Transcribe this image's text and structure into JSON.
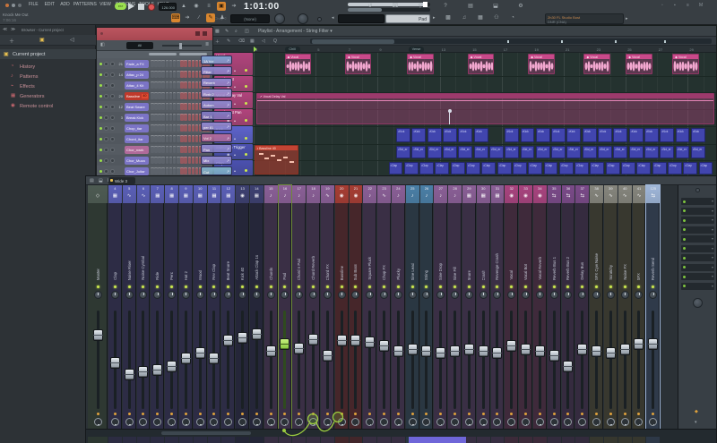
{
  "colors": {
    "toolbar": "#383e43",
    "accent_green": "#9adf4f",
    "record_red": "#e05555",
    "rack_title": "#b8535f",
    "playlist_bg": "#24322f",
    "vocal_track": "#b2437c",
    "kick_track": "#5d62cc",
    "subkick_track": "#4b50b0",
    "clip_tile": "#4145ae",
    "orange_led": "#e0a23c"
  },
  "menu": [
    "FILE",
    "EDIT",
    "ADD",
    "PATTERNS",
    "VIEW",
    "OPTIONS",
    "TOOLS",
    "HELP"
  ],
  "project": {
    "title": "Knock Me Out",
    "time": "7:06:16",
    "free_label": "Free Chop ©"
  },
  "transport": {
    "pat": "PAT",
    "bpm": "126.000",
    "time": "1:01:00",
    "none_lcd": "(None)",
    "pattern_lcd": "Pad"
  },
  "hint": {
    "line1": "2h30  FL Studio Bost",
    "line2": "DNR (CNA)"
  },
  "toolbar": {
    "row1_icons": [
      {
        "g": "▲",
        "n": "metronome-icon"
      },
      {
        "g": "◉",
        "n": "wait-for-input-icon"
      },
      {
        "g": "≡",
        "n": "blend-notes-icon"
      },
      {
        "g": "▣",
        "n": "loop-record-icon",
        "lit": true
      },
      {
        "g": "➔",
        "n": "step-edit-icon"
      }
    ],
    "right1_icons": [
      {
        "g": "↺",
        "n": "sync-icon"
      },
      {
        "g": "⌧",
        "n": "abort-icon"
      },
      {
        "g": "⚲",
        "n": "mic-icon"
      },
      {
        "g": "?",
        "n": "help-icon"
      },
      {
        "g": "▤",
        "n": "save-icon"
      },
      {
        "g": "⬓",
        "n": "monitor-icon"
      },
      {
        "g": "⚙",
        "n": "settings-icon"
      }
    ],
    "row2_icons": [
      {
        "g": "⌨",
        "n": "typing-keyboard-icon",
        "lit": true
      },
      {
        "g": "➔",
        "n": "follow-playback-icon"
      },
      {
        "g": "∕",
        "n": "slide-tool-icon"
      },
      {
        "g": "✎",
        "n": "draw-tool-icon",
        "lit": true
      },
      {
        "g": "♟",
        "n": "smart-macros-icon"
      }
    ],
    "row2b_icons": [
      {
        "g": "▩",
        "n": "playlist-window-icon"
      },
      {
        "g": "♫",
        "n": "piano-roll-window-icon"
      },
      {
        "g": "▦",
        "n": "channel-rack-window-icon"
      },
      {
        "g": "⚇",
        "n": "mixer-window-icon"
      },
      {
        "g": "◔",
        "n": "browser-window-icon"
      }
    ],
    "far_right_icons": [
      {
        "g": "▫",
        "n": "mini-icon-1"
      },
      {
        "g": "▪",
        "n": "mini-icon-2"
      },
      {
        "g": "≡",
        "n": "mini-icon-3"
      },
      {
        "g": "M",
        "n": "midi-icon"
      }
    ]
  },
  "browser": {
    "header": "Browser - Current project",
    "tabs": [
      {
        "g": "＋",
        "n": "browser-add-tab"
      },
      {
        "g": "▣",
        "n": "browser-folder-tab",
        "color": "#e8c050"
      },
      {
        "g": "◁",
        "n": "browser-audio-tab"
      }
    ],
    "root": "Current project",
    "items": [
      {
        "label": "History",
        "g": "◔"
      },
      {
        "label": "Patterns",
        "g": "♪"
      },
      {
        "label": "Effects",
        "g": "⌁"
      },
      {
        "label": "Generators",
        "g": "▦"
      },
      {
        "label": "Remote control",
        "g": "◉"
      }
    ]
  },
  "rack": {
    "filter": "All",
    "channels": [
      {
        "num": "21",
        "name": "Fade_a FX"
      },
      {
        "num": "14",
        "name": "Attac_p 24"
      },
      {
        "num": "",
        "name": "Attac_4 Kit"
      },
      {
        "num": "20",
        "name": "Bassline",
        "badge": "40",
        "selected": true
      },
      {
        "num": "12",
        "name": "Beat Sware"
      },
      {
        "num": "3",
        "name": "Break Kick"
      },
      {
        "num": "",
        "name": "Chop_itar"
      },
      {
        "num": "",
        "name": "Chord_itar"
      },
      {
        "num": "",
        "name": "Chor_nwrk",
        "pink": true
      },
      {
        "num": "",
        "name": "Chor_Muza"
      },
      {
        "num": "",
        "name": "Chor_Juitar"
      }
    ]
  },
  "side_buttons": [
    {
      "label": "1A Vol",
      "color": "#7f9fd0"
    },
    {
      "label": "Filter",
      "color": "#8d86cc"
    },
    {
      "label": "Reverb",
      "color": "#8d86cc"
    },
    {
      "label": "Rvrb 2",
      "color": "#9a8fd0"
    },
    {
      "label": "Autom",
      "color": "#8d86cc"
    },
    {
      "label": "Bar 1",
      "color": "#7f78c0"
    },
    {
      "label": "per 81",
      "color": "#8d86cc"
    },
    {
      "label": "Vol 2",
      "color": "#b06a9a"
    },
    {
      "label": "Pan",
      "color": "#8d86cc"
    },
    {
      "label": "Mix",
      "color": "#8d86cc"
    },
    {
      "label": "Cut",
      "color": "#7fb0c8"
    }
  ],
  "playlist": {
    "title": "Playlist - Arrangement - String Filter",
    "title_icons": [
      {
        "g": "▩",
        "n": "playlist-menu-icon"
      },
      {
        "g": "✎",
        "n": "playlist-draw-icon"
      },
      {
        "g": "⌕",
        "n": "playlist-zoom-icon"
      },
      {
        "g": "◫",
        "n": "playlist-view-icon"
      }
    ],
    "tool_icons": [
      {
        "g": "＋",
        "n": "pl-add-icon"
      },
      {
        "g": "✎",
        "n": "pl-pencil-icon"
      },
      {
        "g": "⌫",
        "n": "pl-delete-icon"
      },
      {
        "g": "▦",
        "n": "pl-paint-icon"
      },
      {
        "g": "◁",
        "n": "pl-playback-icon"
      },
      {
        "g": "Q",
        "n": "pl-quantize-icon"
      }
    ],
    "markers": [
      {
        "label": "Chill",
        "bar": 3
      },
      {
        "label": "Verse",
        "bar": 11
      }
    ],
    "bar_labels": [
      1,
      3,
      5,
      7,
      9,
      11,
      13,
      15,
      17,
      19,
      21,
      23,
      25,
      27,
      29
    ],
    "tracks": [
      {
        "name": "Vocal",
        "color": "#b2437c",
        "h": 26
      },
      {
        "name": "Vocal Bost",
        "color": "#b2437c",
        "h": 18
      },
      {
        "name": "Vocal Delay Val",
        "color": "#b2437c",
        "h": 19
      },
      {
        "name": "Vocal Bost Pan",
        "color": "#b2437c",
        "h": 19
      },
      {
        "name": "Kick",
        "color": "#5d62cc",
        "h": 20
      },
      {
        "name": "Sidechain Trigger",
        "color": "#4b50b0",
        "h": 18
      },
      {
        "name": "Clap",
        "color": "#4b50b0",
        "h": 18
      }
    ],
    "audio_clips": {
      "label": "Vocal",
      "track": 0,
      "len": 1.7,
      "starts": [
        3,
        6.9,
        10.9,
        14.8,
        18.7,
        22.3,
        25.0,
        28.0
      ]
    },
    "automation_clip": {
      "label": "Vocal Delay Val",
      "track": 2,
      "span": 2,
      "start": 1.2,
      "end": 30.8
    },
    "pattern_clip": {
      "label": "Bassline 40",
      "track": 5,
      "span": 2,
      "start": 1.05,
      "end": 3.9
    },
    "tiled_clips": [
      {
        "label": "Kick",
        "track": 4,
        "start": 10.2,
        "end": 30,
        "gap": 16
      },
      {
        "label": "Sid_er",
        "track": 5,
        "start": 10.2,
        "end": 30
      },
      {
        "label": "Clap",
        "track": 6,
        "start": 9.7,
        "end": 30
      }
    ]
  },
  "mixer": {
    "tab": "Wide 3",
    "title_icons": [
      {
        "g": "▤",
        "n": "mixer-menu-icon"
      },
      {
        "g": "⬓",
        "n": "mixer-detach-icon"
      },
      {
        "g": "⧉",
        "n": "mixer-layout-icon"
      }
    ],
    "groups": {
      "master": {
        "h": "#4d5a52",
        "b": "#2e3832"
      },
      "blue": {
        "h": "#5a5fb6",
        "b": "#2d2c45"
      },
      "navy": {
        "h": "#3d4070",
        "b": "#252639"
      },
      "mauve": {
        "h": "#8a5f96",
        "b": "#3a2f45"
      },
      "red": {
        "h": "#a63d33",
        "b": "#46262a"
      },
      "steel": {
        "h": "#4a7fa6",
        "b": "#2a3742"
      },
      "magenta": {
        "h": "#a8437e",
        "b": "#3f2a3b"
      },
      "bus": {
        "h": "#7a4a88",
        "b": "#352b3f"
      },
      "gray": {
        "h": "#85857d",
        "b": "#38382f"
      },
      "send": {
        "h": "#9fb6d8",
        "b": "#2f3a4a"
      }
    },
    "strips": [
      {
        "num": "",
        "name": "Master",
        "group": "master",
        "fader": 0.78,
        "icon": "◇"
      },
      {
        "num": "4",
        "name": "Clap",
        "group": "blue",
        "fader": 0.46,
        "icon": "▦"
      },
      {
        "num": "5",
        "name": "Noise Riser",
        "group": "blue",
        "fader": 0.33,
        "icon": "∿"
      },
      {
        "num": "6",
        "name": "Noise Cymbal",
        "group": "blue",
        "fader": 0.36,
        "icon": "∿"
      },
      {
        "num": "7",
        "name": "Ride",
        "group": "blue",
        "fader": 0.38,
        "icon": "▦"
      },
      {
        "num": "8",
        "name": "Perc",
        "group": "blue",
        "fader": 0.42,
        "icon": "▦"
      },
      {
        "num": "9",
        "name": "Hat 2",
        "group": "blue",
        "fader": 0.52,
        "icon": "▦"
      },
      {
        "num": "10",
        "name": "Wood",
        "group": "blue",
        "fader": 0.58,
        "icon": "▦"
      },
      {
        "num": "11",
        "name": "Rev Clap",
        "group": "blue",
        "fader": 0.52,
        "icon": "▦"
      },
      {
        "num": "12",
        "name": "Beat Snare",
        "group": "blue",
        "fader": 0.72,
        "icon": "▦"
      },
      {
        "num": "13",
        "name": "Kick 40",
        "group": "navy",
        "fader": 0.75,
        "icon": "◉"
      },
      {
        "num": "14",
        "name": "Attack Clap 1s",
        "group": "navy",
        "fader": 0.79,
        "icon": "▦"
      },
      {
        "num": "15",
        "name": "Chords",
        "group": "mauve",
        "fader": 0.6,
        "icon": "♪"
      },
      {
        "num": "16",
        "name": "Pad",
        "group": "mauve",
        "fader": 0.68,
        "icon": "♪",
        "selected": true
      },
      {
        "num": "17",
        "name": "Chord n Pad",
        "group": "mauve",
        "fader": 0.63,
        "icon": "♪"
      },
      {
        "num": "18",
        "name": "Chord Reverb",
        "group": "mauve",
        "fader": 0.73,
        "icon": "♪"
      },
      {
        "num": "19",
        "name": "Chord FX",
        "group": "mauve",
        "fader": 0.55,
        "icon": "∿"
      },
      {
        "num": "20",
        "name": "Bassline",
        "group": "red",
        "fader": 0.72,
        "icon": "◉"
      },
      {
        "num": "21",
        "name": "Sub Bass",
        "group": "red",
        "fader": 0.72,
        "icon": "◉"
      },
      {
        "num": "22",
        "name": "Square Pluck",
        "group": "mauve",
        "fader": 0.7,
        "icon": "♪"
      },
      {
        "num": "23",
        "name": "Chop FX",
        "group": "mauve",
        "fader": 0.66,
        "icon": "∿"
      },
      {
        "num": "24",
        "name": "Plucky",
        "group": "mauve",
        "fader": 0.6,
        "icon": "♪"
      },
      {
        "num": "25",
        "name": "Sine Lead",
        "group": "steel",
        "fader": 0.62,
        "icon": "♪"
      },
      {
        "num": "26",
        "name": "String",
        "group": "steel",
        "fader": 0.6,
        "icon": "♪"
      },
      {
        "num": "27",
        "name": "Sine Drop",
        "group": "mauve",
        "fader": 0.58,
        "icon": "♪"
      },
      {
        "num": "28",
        "name": "Sine Fill",
        "group": "mauve",
        "fader": 0.6,
        "icon": "♪"
      },
      {
        "num": "29",
        "name": "Snare",
        "group": "mauve",
        "fader": 0.62,
        "icon": "▦"
      },
      {
        "num": "30",
        "name": "Crash",
        "group": "mauve",
        "fader": 0.6,
        "icon": "▦"
      },
      {
        "num": "31",
        "name": "Revenge Crash",
        "group": "mauve",
        "fader": 0.58,
        "icon": "▦"
      },
      {
        "num": "32",
        "name": "Vocal",
        "group": "magenta",
        "fader": 0.66,
        "icon": "◉"
      },
      {
        "num": "33",
        "name": "Vocal Bot",
        "group": "magenta",
        "fader": 0.62,
        "icon": "◉"
      },
      {
        "num": "34",
        "name": "Vocal Reverb",
        "group": "magenta",
        "fader": 0.6,
        "icon": "◉"
      },
      {
        "num": "35",
        "name": "Reverb Bus 1",
        "group": "bus",
        "fader": 0.55,
        "icon": "⇆"
      },
      {
        "num": "36",
        "name": "Reverb Bus 2",
        "group": "bus",
        "fader": 0.42,
        "icon": "⇆"
      },
      {
        "num": "37",
        "name": "Delay Bus",
        "group": "bus",
        "fader": 0.62,
        "icon": "⇆"
      },
      {
        "num": "38",
        "name": "SFX Cyw Noise",
        "group": "gray",
        "fader": 0.6,
        "icon": "∿"
      },
      {
        "num": "39",
        "name": "Scratchy",
        "group": "gray",
        "fader": 0.58,
        "icon": "∿"
      },
      {
        "num": "40",
        "name": "Noise FX",
        "group": "gray",
        "fader": 0.62,
        "icon": "∿"
      },
      {
        "num": "41",
        "name": "SFX",
        "group": "gray",
        "fader": 0.68,
        "icon": "∿"
      },
      {
        "num": "125",
        "name": "Reverb Send",
        "group": "send",
        "fader": 0.68,
        "icon": "⇆",
        "selected2": true
      }
    ]
  }
}
